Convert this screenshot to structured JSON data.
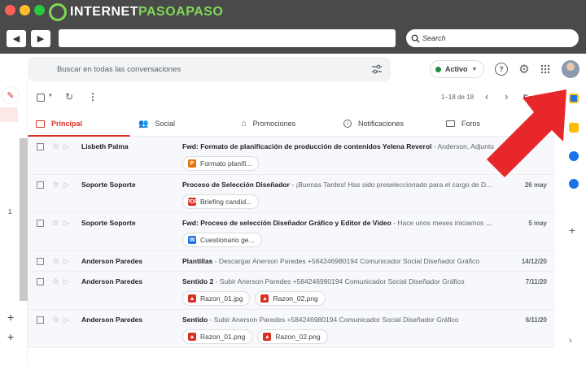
{
  "browser": {
    "brand_main": "INTERNET",
    "brand_accent": "PASOAPASO",
    "search_placeholder": "Search",
    "back_icon": "◀",
    "forward_icon": "▶"
  },
  "gmail": {
    "search_placeholder": "Buscar en todas las conversaciones",
    "status_label": "Activo",
    "pagination": "1–18 de 18",
    "lang": "Es",
    "tabs": [
      {
        "label": "Principal",
        "icon": "inbox-icon"
      },
      {
        "label": "Social",
        "icon": "people-icon"
      },
      {
        "label": "Promociones",
        "icon": "tag-icon"
      },
      {
        "label": "Notificaciones",
        "icon": "info-icon"
      },
      {
        "label": "Foros",
        "icon": "forum-icon"
      }
    ],
    "left_count": "1",
    "emails": [
      {
        "sender": "Lisbeth Palma",
        "subject": "Fwd: Formato de planificación de producción de contenidos Yelena Reverol",
        "snippet": " - Anderson, Adjunto",
        "date": "",
        "attachments": [
          {
            "name": "Formato planifi...",
            "type": "P",
            "color": "#e8710a"
          }
        ]
      },
      {
        "sender": "Soporte Soporte",
        "subject": "Proceso de Selección Diseñador",
        "snippet": " - ¡Buenas Tardes! Has sido preseleccionado para el cargo de D...",
        "date": "26 may",
        "attachments": [
          {
            "name": "Briefing candid...",
            "type": "PDF",
            "color": "#d93025"
          }
        ]
      },
      {
        "sender": "Soporte Soporte",
        "subject": "Fwd: Proceso de selección Diseñador Gráfico y Editor de Video",
        "snippet": " - Hace unos meses iniciamos un...",
        "date": "5 may",
        "attachments": [
          {
            "name": "Cuestionario ge...",
            "type": "W",
            "color": "#1a73e8"
          }
        ]
      },
      {
        "sender": "Anderson Paredes",
        "subject": "Plantillas",
        "snippet": " - Descargar Anerson Paredes +584246980194 Comunicador Social Diseñador Gráfico",
        "date": "14/12/20",
        "attachments": []
      },
      {
        "sender": "Anderson Paredes",
        "subject": "Sentido 2",
        "snippet": " - Subir Anerson Paredes +584246980194 Comunicador Social Diseñador Gráfico",
        "date": "7/11/20",
        "attachments": [
          {
            "name": "Razon_01.jpg",
            "type": "▲",
            "color": "#d93025"
          },
          {
            "name": "Razon_02.png",
            "type": "▲",
            "color": "#d93025"
          }
        ]
      },
      {
        "sender": "Anderson Paredes",
        "subject": "Sentido",
        "snippet": " - Subir Anerson Paredes +584246980194 Comunicador Social Diseñador Gráfico",
        "date": "6/11/20",
        "attachments": [
          {
            "name": "Razon_01.png",
            "type": "▲",
            "color": "#d93025"
          },
          {
            "name": "Razon_02.png",
            "type": "▲",
            "color": "#d93025"
          }
        ]
      }
    ]
  },
  "colors": {
    "accent": "#d93025",
    "arrow": "#e8272a",
    "brand_green": "#7ed957"
  }
}
